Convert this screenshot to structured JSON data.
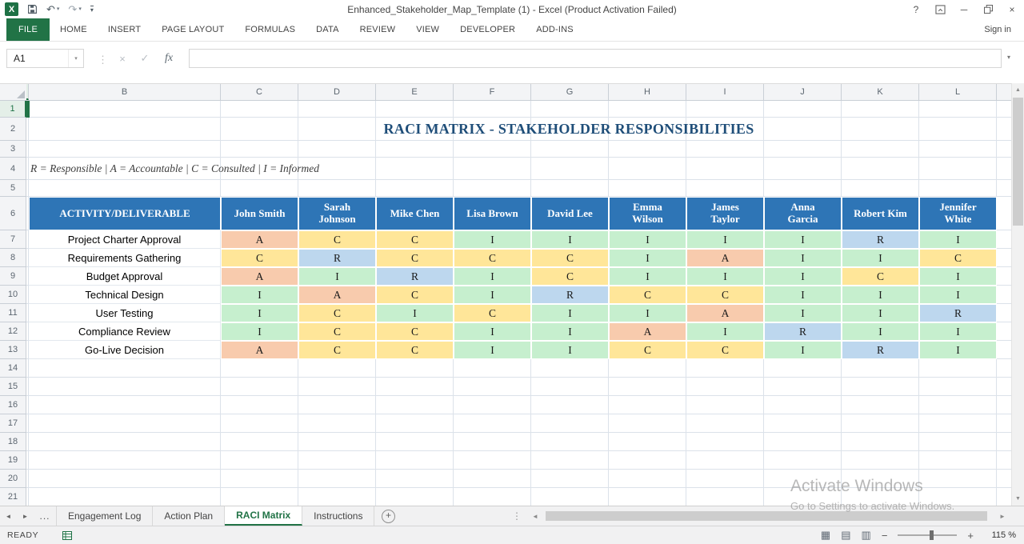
{
  "titlebar": {
    "title": "Enhanced_Stakeholder_Map_Template (1) - Excel (Product Activation Failed)"
  },
  "ribbon": {
    "tabs": [
      {
        "label": "FILE",
        "file": true
      },
      {
        "label": "HOME"
      },
      {
        "label": "INSERT"
      },
      {
        "label": "PAGE LAYOUT"
      },
      {
        "label": "FORMULAS"
      },
      {
        "label": "DATA"
      },
      {
        "label": "REVIEW"
      },
      {
        "label": "VIEW"
      },
      {
        "label": "DEVELOPER"
      },
      {
        "label": "ADD-INS"
      }
    ],
    "sign_in": "Sign in"
  },
  "formula_bar": {
    "name_box": "A1",
    "fx_label": "fx",
    "formula_value": ""
  },
  "sheet": {
    "column_letters": [
      "B",
      "C",
      "D",
      "E",
      "F",
      "G",
      "H",
      "I",
      "J",
      "K",
      "L"
    ],
    "row_numbers": [
      "1",
      "2",
      "3",
      "4",
      "5",
      "6",
      "7",
      "8",
      "9",
      "10",
      "11",
      "12",
      "13",
      "14",
      "15",
      "16",
      "17",
      "18",
      "19",
      "20",
      "21"
    ],
    "title": "RACI MATRIX - STAKEHOLDER RESPONSIBILITIES",
    "legend": "R = Responsible | A = Accountable | C = Consulted | I = Informed"
  },
  "raci": {
    "header_bg": "#2E75B6",
    "value_colors": {
      "R": "#BDD7EE",
      "A": "#F8CBAD",
      "C": "#FFE699",
      "I": "#C6EFCE"
    },
    "columns": [
      "ACTIVITY/DELIVERABLE",
      "John Smith",
      "Sarah\nJohnson",
      "Mike Chen",
      "Lisa Brown",
      "David Lee",
      "Emma\nWilson",
      "James\nTaylor",
      "Anna\nGarcia",
      "Robert Kim",
      "Jennifer\nWhite"
    ],
    "rows": [
      {
        "activity": "Project Charter Approval",
        "values": [
          "A",
          "C",
          "C",
          "I",
          "I",
          "I",
          "I",
          "I",
          "R",
          "I"
        ]
      },
      {
        "activity": "Requirements Gathering",
        "values": [
          "C",
          "R",
          "C",
          "C",
          "C",
          "I",
          "A",
          "I",
          "I",
          "C"
        ]
      },
      {
        "activity": "Budget Approval",
        "values": [
          "A",
          "I",
          "R",
          "I",
          "C",
          "I",
          "I",
          "I",
          "C",
          "I"
        ]
      },
      {
        "activity": "Technical Design",
        "values": [
          "I",
          "A",
          "C",
          "I",
          "R",
          "C",
          "C",
          "I",
          "I",
          "I"
        ]
      },
      {
        "activity": "User Testing",
        "values": [
          "I",
          "C",
          "I",
          "C",
          "I",
          "I",
          "A",
          "I",
          "I",
          "R"
        ]
      },
      {
        "activity": "Compliance Review",
        "values": [
          "I",
          "C",
          "C",
          "I",
          "I",
          "A",
          "I",
          "R",
          "I",
          "I"
        ]
      },
      {
        "activity": "Go-Live Decision",
        "values": [
          "A",
          "C",
          "C",
          "I",
          "I",
          "C",
          "C",
          "I",
          "R",
          "I"
        ]
      }
    ]
  },
  "sheet_tabs": {
    "overflow": "...",
    "tabs": [
      {
        "label": "Engagement Log"
      },
      {
        "label": "Action Plan"
      },
      {
        "label": "RACI Matrix",
        "active": true
      },
      {
        "label": "Instructions"
      }
    ]
  },
  "status_bar": {
    "mode": "READY",
    "zoom": "115 %"
  },
  "watermark": {
    "line1": "Activate Windows",
    "line2": "Go to Settings to activate Windows."
  },
  "colors": {
    "excel_green": "#217346",
    "title_text": "#1F4E79"
  },
  "icons": {
    "help": "?",
    "minimize": "─",
    "close": "×",
    "undo": "↶",
    "redo": "↷",
    "dropdown": "▾",
    "cancel": "×",
    "enter": "✓",
    "scroll_up": "▲",
    "scroll_down": "▼",
    "scroll_left": "◄",
    "scroll_right": "►",
    "tab_prev": "◄",
    "tab_next": "►",
    "new_sheet": "+",
    "splitter": "⋮",
    "zoom_out": "−",
    "zoom_in": "+",
    "view_normal": "▦",
    "view_layout": "▤",
    "view_break": "▥"
  }
}
